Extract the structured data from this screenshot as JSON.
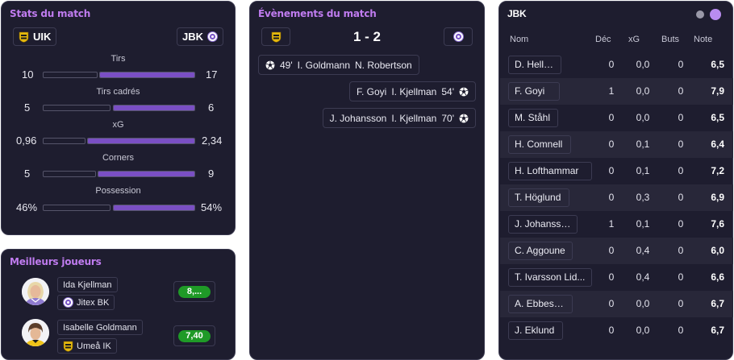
{
  "stats": {
    "title": "Stats du match",
    "home_team": "UIK",
    "away_team": "JBK",
    "rows": [
      {
        "label": "Tirs",
        "home": "10",
        "away": "17",
        "home_share": 0.37,
        "away_share": 0.63
      },
      {
        "label": "Tirs cadrés",
        "home": "5",
        "away": "6",
        "home_share": 0.45,
        "away_share": 0.55
      },
      {
        "label": "xG",
        "home": "0,96",
        "away": "2,34",
        "home_share": 0.29,
        "away_share": 0.71
      },
      {
        "label": "Corners",
        "home": "5",
        "away": "9",
        "home_share": 0.36,
        "away_share": 0.64
      },
      {
        "label": "Possession",
        "home": "46%",
        "away": "54%",
        "home_share": 0.46,
        "away_share": 0.54
      }
    ],
    "bar_color": "#7a4fc4"
  },
  "best": {
    "title": "Meilleurs joueurs",
    "players": [
      {
        "name": "Ida Kjellman",
        "team": "Jitex BK",
        "rating": "8,...",
        "team_icon": "jbk-logo-icon"
      },
      {
        "name": "Isabelle Goldmann",
        "team": "Umeå IK",
        "rating": "7,40",
        "team_icon": "uik-logo-icon"
      }
    ],
    "rating_color": "#1f9a27"
  },
  "events": {
    "title": "Évènements du match",
    "score": "1 - 2",
    "items": [
      {
        "minute": "49'",
        "scorer": "I. Goldmann",
        "assist": "N. Robertson",
        "side": "home",
        "icon": "ball-icon"
      },
      {
        "minute": "54'",
        "scorer": "F. Goyi",
        "assist": "I. Kjellman",
        "side": "away",
        "icon": "ball-icon"
      },
      {
        "minute": "70'",
        "scorer": "J. Johansson",
        "assist": "I. Kjellman",
        "side": "away",
        "icon": "ball-icon"
      }
    ]
  },
  "table": {
    "title": "JBK",
    "headers": {
      "name": "Nom",
      "dec": "Déc",
      "xg": "xG",
      "goals": "Buts",
      "note": "Note"
    },
    "rows": [
      {
        "name": "D. Hellwig",
        "dec": "0",
        "xg": "0,0",
        "goals": "0",
        "note": "6,5"
      },
      {
        "name": "F. Goyi",
        "dec": "1",
        "xg": "0,0",
        "goals": "0",
        "note": "7,9"
      },
      {
        "name": "M. Ståhl",
        "dec": "0",
        "xg": "0,0",
        "goals": "0",
        "note": "6,5"
      },
      {
        "name": "H. Comnell",
        "dec": "0",
        "xg": "0,1",
        "goals": "0",
        "note": "6,4"
      },
      {
        "name": "H. Lofthammar",
        "dec": "0",
        "xg": "0,1",
        "goals": "0",
        "note": "7,2"
      },
      {
        "name": "T. Höglund",
        "dec": "0",
        "xg": "0,3",
        "goals": "0",
        "note": "6,9"
      },
      {
        "name": "J. Johansson",
        "dec": "1",
        "xg": "0,1",
        "goals": "0",
        "note": "7,6"
      },
      {
        "name": "C. Aggoune",
        "dec": "0",
        "xg": "0,4",
        "goals": "0",
        "note": "6,0"
      },
      {
        "name": "T. Ivarsson Lid...",
        "dec": "0",
        "xg": "0,4",
        "goals": "0",
        "note": "6,6"
      },
      {
        "name": "A. Ebbesson",
        "dec": "0",
        "xg": "0,0",
        "goals": "0",
        "note": "6,7"
      },
      {
        "name": "J. Eklund",
        "dec": "0",
        "xg": "0,0",
        "goals": "0",
        "note": "6,7"
      }
    ],
    "dot_colors": [
      "#9a99a8",
      "#b98cf0"
    ]
  }
}
